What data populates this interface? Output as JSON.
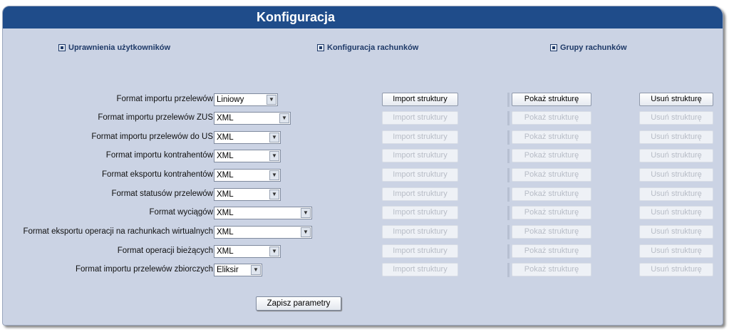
{
  "header": {
    "title": "Konfiguracja"
  },
  "nav": {
    "users": "Uprawnienia użytkowników",
    "accounts_config": "Konfiguracja rachunków",
    "account_groups": "Grupy rachunków"
  },
  "buttons": {
    "import": "Import struktury",
    "show": "Pokaż strukturę",
    "delete": "Usuń strukturę",
    "save": "Zapisz parametry"
  },
  "rows": [
    {
      "label": "Format importu przelewów",
      "value": "Liniowy",
      "enabled": true
    },
    {
      "label": "Format importu przelewów ZUS",
      "value": "XML",
      "enabled": false
    },
    {
      "label": "Format importu przelewów do US",
      "value": "XML",
      "enabled": false
    },
    {
      "label": "Format importu kontrahentów",
      "value": "XML",
      "enabled": false
    },
    {
      "label": "Format eksportu kontrahentów",
      "value": "XML",
      "enabled": false
    },
    {
      "label": "Format statusów przelewów",
      "value": "XML",
      "enabled": false
    },
    {
      "label": "Format wyciągów",
      "value": "XML",
      "enabled": false
    },
    {
      "label": "Format eksportu operacji na rachunkach wirtualnych",
      "value": "XML",
      "enabled": false
    },
    {
      "label": "Format operacji bieżących",
      "value": "XML",
      "enabled": false
    },
    {
      "label": "Format importu przelewów zbiorczych",
      "value": "Eliksir",
      "enabled": false
    }
  ]
}
